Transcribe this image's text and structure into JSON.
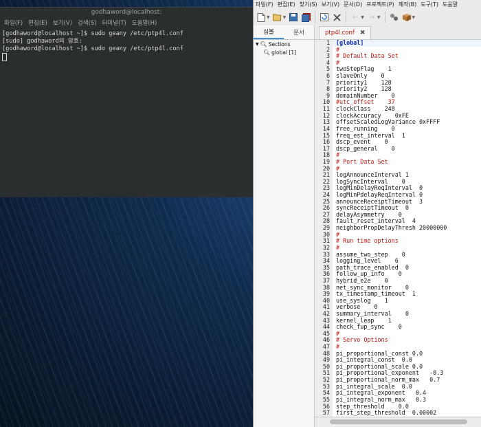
{
  "terminal": {
    "title": "godhaword@localhost:",
    "menu": [
      "파일(F)",
      "편집(E)",
      "보기(V)",
      "검색(S)",
      "터미널(T)",
      "도움말(H)"
    ],
    "lines": [
      "[godhaword@localhost ~]$ sudo geany /etc/ptp4l.conf",
      "[sudo] godhaword의 암호:",
      "[godhaword@localhost ~]$ sudo geany /etc/ptp4l.conf"
    ]
  },
  "editor": {
    "menu": [
      "파일(F)",
      "편집(E)",
      "찾기(S)",
      "보기(V)",
      "문서(D)",
      "프로젝트(P)",
      "제작(B)",
      "도구(T)",
      "도움말"
    ],
    "sidebar": {
      "tabs": [
        "심볼",
        "문서"
      ],
      "tree_root": "Sections",
      "tree_child": "global [1]"
    },
    "tab": {
      "filename": "ptp4l.conf",
      "close": "✖"
    },
    "lines": [
      {
        "n": "1",
        "t": "[global]",
        "k": "section"
      },
      {
        "n": "2",
        "t": "#",
        "k": "comment"
      },
      {
        "n": "3",
        "t": "# Default Data Set",
        "k": "comment"
      },
      {
        "n": "4",
        "t": "#",
        "k": "comment"
      },
      {
        "n": "5",
        "t": "twoStepFlag    1",
        "k": "kv"
      },
      {
        "n": "6",
        "t": "slaveOnly    0",
        "k": "kv"
      },
      {
        "n": "7",
        "t": "priority1    128",
        "k": "kv"
      },
      {
        "n": "8",
        "t": "priority2    128",
        "k": "kv"
      },
      {
        "n": "9",
        "t": "domainNumber    0",
        "k": "kv"
      },
      {
        "n": "10",
        "t": "#utc_offset    37",
        "k": "comment"
      },
      {
        "n": "11",
        "t": "clockClass    248",
        "k": "kv"
      },
      {
        "n": "12",
        "t": "clockAccuracy    0xFE",
        "k": "kv"
      },
      {
        "n": "13",
        "t": "offsetScaledLogVariance 0xFFFF",
        "k": "kv"
      },
      {
        "n": "14",
        "t": "free_running    0",
        "k": "kv"
      },
      {
        "n": "15",
        "t": "freq_est_interval  1",
        "k": "kv"
      },
      {
        "n": "16",
        "t": "dscp_event    0",
        "k": "kv"
      },
      {
        "n": "17",
        "t": "dscp_general    0",
        "k": "kv"
      },
      {
        "n": "18",
        "t": "#",
        "k": "comment"
      },
      {
        "n": "19",
        "t": "# Port Data Set",
        "k": "comment"
      },
      {
        "n": "20",
        "t": "#",
        "k": "comment"
      },
      {
        "n": "21",
        "t": "logAnnounceInterval 1",
        "k": "kv"
      },
      {
        "n": "22",
        "t": "logSyncInterval    0",
        "k": "kv"
      },
      {
        "n": "23",
        "t": "logMinDelayReqInterval  0",
        "k": "kv"
      },
      {
        "n": "24",
        "t": "logMinPdelayReqInterval 0",
        "k": "kv"
      },
      {
        "n": "25",
        "t": "announceReceiptTimeout  3",
        "k": "kv"
      },
      {
        "n": "26",
        "t": "syncReceiptTimeout  0",
        "k": "kv"
      },
      {
        "n": "27",
        "t": "delayAsymmetry    0",
        "k": "kv"
      },
      {
        "n": "28",
        "t": "fault_reset_interval  4",
        "k": "kv"
      },
      {
        "n": "29",
        "t": "neighborPropDelayThresh 20000000",
        "k": "kv"
      },
      {
        "n": "30",
        "t": "#",
        "k": "comment"
      },
      {
        "n": "31",
        "t": "# Run time options",
        "k": "comment"
      },
      {
        "n": "32",
        "t": "#",
        "k": "comment"
      },
      {
        "n": "33",
        "t": "assume_two_step    0",
        "k": "kv"
      },
      {
        "n": "34",
        "t": "logging_level    6",
        "k": "kv"
      },
      {
        "n": "35",
        "t": "path_trace_enabled  0",
        "k": "kv"
      },
      {
        "n": "36",
        "t": "follow_up_info    0",
        "k": "kv"
      },
      {
        "n": "37",
        "t": "hybrid_e2e    0",
        "k": "kv"
      },
      {
        "n": "38",
        "t": "net_sync_monitor    0",
        "k": "kv"
      },
      {
        "n": "39",
        "t": "tx_timestamp_timeout  1",
        "k": "kv"
      },
      {
        "n": "40",
        "t": "use_syslog    1",
        "k": "kv"
      },
      {
        "n": "41",
        "t": "verbose    0",
        "k": "kv"
      },
      {
        "n": "42",
        "t": "summary_interval    0",
        "k": "kv"
      },
      {
        "n": "43",
        "t": "kernel_leap    1",
        "k": "kv"
      },
      {
        "n": "44",
        "t": "check_fup_sync    0",
        "k": "kv"
      },
      {
        "n": "45",
        "t": "#",
        "k": "comment"
      },
      {
        "n": "46",
        "t": "# Servo Options",
        "k": "comment"
      },
      {
        "n": "47",
        "t": "#",
        "k": "comment"
      },
      {
        "n": "48",
        "t": "pi_proportional_const 0.0",
        "k": "kv"
      },
      {
        "n": "49",
        "t": "pi_integral_const  0.0",
        "k": "kv"
      },
      {
        "n": "50",
        "t": "pi_proportional_scale 0.0",
        "k": "kv"
      },
      {
        "n": "51",
        "t": "pi_proportional_exponent   -0.3",
        "k": "kv"
      },
      {
        "n": "52",
        "t": "pi_proportional_norm_max   0.7",
        "k": "kv"
      },
      {
        "n": "53",
        "t": "pi_integral_scale  0.0",
        "k": "kv"
      },
      {
        "n": "54",
        "t": "pi_integral_exponent   0.4",
        "k": "kv"
      },
      {
        "n": "55",
        "t": "pi_integral_norm_max   0.3",
        "k": "kv"
      },
      {
        "n": "56",
        "t": "step_threshold    0.0",
        "k": "kv"
      },
      {
        "n": "57",
        "t": "first_step_threshold  0.00002",
        "k": "kv"
      }
    ]
  },
  "icons": {
    "new": "new-file-icon",
    "open": "open-file-icon",
    "save": "save-icon",
    "saveall": "save-all-icon",
    "reload": "reload-icon",
    "close": "close-icon",
    "back": "back-icon",
    "forward": "forward-icon",
    "compile": "compile-icon",
    "build": "build-icon"
  }
}
